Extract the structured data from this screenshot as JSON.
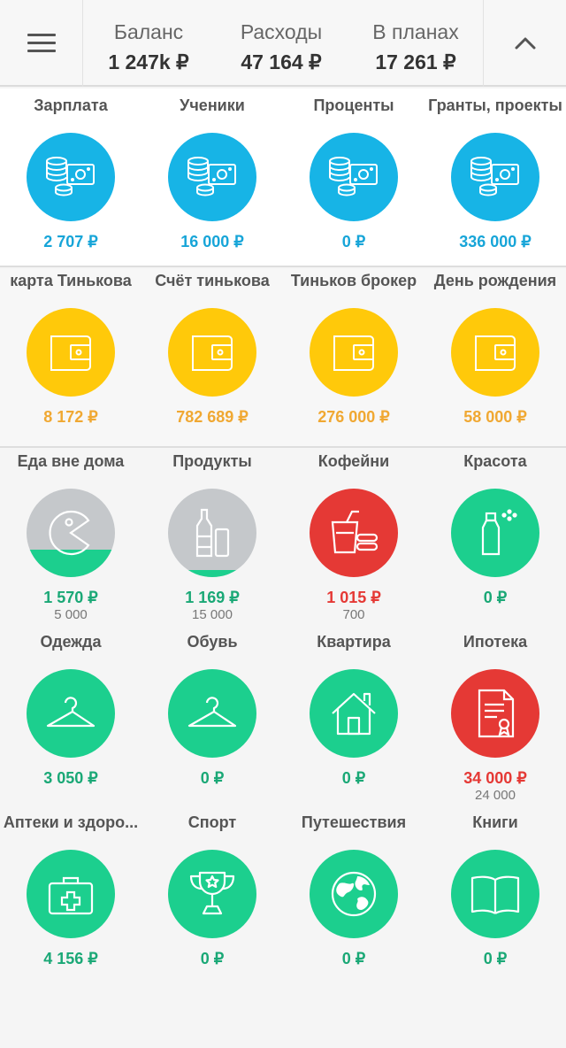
{
  "header": {
    "balance": {
      "label": "Баланс",
      "value": "1 247k ₽"
    },
    "expenses": {
      "label": "Расходы",
      "value": "47 164 ₽"
    },
    "plans": {
      "label": "В планах",
      "value": "17 261 ₽"
    }
  },
  "income": [
    {
      "name": "Зарплата",
      "amount": "2 707 ₽"
    },
    {
      "name": "Ученики",
      "amount": "16 000 ₽"
    },
    {
      "name": "Проценты",
      "amount": "0 ₽"
    },
    {
      "name": "Гранты, проекты",
      "amount": "336 000 ₽"
    }
  ],
  "accounts": [
    {
      "name": "карта Тинькова",
      "amount": "8 172 ₽"
    },
    {
      "name": "Счёт тинькова",
      "amount": "782 689 ₽"
    },
    {
      "name": "Тиньков брокер",
      "amount": "276 000 ₽"
    },
    {
      "name": "День рождения",
      "amount": "58 000 ₽"
    }
  ],
  "expenses": [
    {
      "name": "Еда вне дома",
      "amount": "1 570 ₽",
      "limit": "5 000",
      "icon": "pacman-icon",
      "color": "gray",
      "fill": 0.31,
      "amount_color": "green"
    },
    {
      "name": "Продукты",
      "amount": "1 169 ₽",
      "limit": "15 000",
      "icon": "bottles-icon",
      "color": "gray",
      "fill": 0.08,
      "amount_color": "green"
    },
    {
      "name": "Кофейни",
      "amount": "1 015 ₽",
      "limit": "700",
      "icon": "coffee-icon",
      "color": "red",
      "fill": 0,
      "amount_color": "red"
    },
    {
      "name": "Красота",
      "amount": "0 ₽",
      "limit": "",
      "icon": "perfume-icon",
      "color": "green",
      "fill": 0,
      "amount_color": "green"
    },
    {
      "name": "Одежда",
      "amount": "3 050 ₽",
      "limit": "",
      "icon": "hanger-icon",
      "color": "green",
      "fill": 0,
      "amount_color": "green"
    },
    {
      "name": "Обувь",
      "amount": "0 ₽",
      "limit": "",
      "icon": "hanger-icon",
      "color": "green",
      "fill": 0,
      "amount_color": "green"
    },
    {
      "name": "Квартира",
      "amount": "0 ₽",
      "limit": "",
      "icon": "house-icon",
      "color": "green",
      "fill": 0,
      "amount_color": "green"
    },
    {
      "name": "Ипотека",
      "amount": "34 000 ₽",
      "limit": "24 000",
      "icon": "certificate-icon",
      "color": "red",
      "fill": 0,
      "amount_color": "red"
    },
    {
      "name": "Аптеки и здоро...",
      "amount": "4 156 ₽",
      "limit": "",
      "icon": "first-aid-icon",
      "color": "green",
      "fill": 0,
      "amount_color": "green"
    },
    {
      "name": "Спорт",
      "amount": "0 ₽",
      "limit": "",
      "icon": "trophy-icon",
      "color": "green",
      "fill": 0,
      "amount_color": "green"
    },
    {
      "name": "Путешествия",
      "amount": "0 ₽",
      "limit": "",
      "icon": "globe-icon",
      "color": "green",
      "fill": 0,
      "amount_color": "green"
    },
    {
      "name": "Книги",
      "amount": "0 ₽",
      "limit": "",
      "icon": "book-icon",
      "color": "green",
      "fill": 0,
      "amount_color": "green"
    }
  ],
  "colors": {
    "income": "#17b4e6",
    "accounts": "#ffc90a",
    "ok": "#1ccf8e",
    "over": "#e53935",
    "empty": "#c5c8cb"
  }
}
